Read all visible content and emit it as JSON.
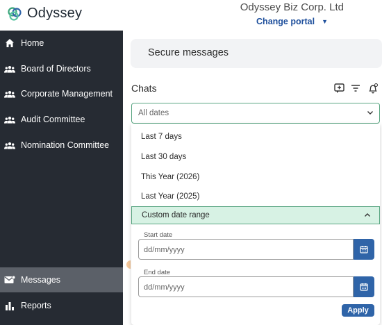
{
  "header": {
    "app_name": "Odyssey",
    "company": "Odyssey Biz Corp. Ltd",
    "change_portal": "Change portal"
  },
  "sidebar": {
    "items": [
      {
        "label": "Home",
        "icon": "home-icon"
      },
      {
        "label": "Board of Directors",
        "icon": "people-icon"
      },
      {
        "label": "Corporate Management",
        "icon": "people-icon"
      },
      {
        "label": "Audit Committee",
        "icon": "people-icon"
      },
      {
        "label": "Nomination Committee",
        "icon": "people-icon"
      },
      {
        "label": "Messages",
        "icon": "mail-icon",
        "active": true
      },
      {
        "label": "Reports",
        "icon": "bar-chart-icon"
      }
    ]
  },
  "main": {
    "title": "Secure messages",
    "chats_label": "Chats",
    "date_filter": {
      "selected": "All dates",
      "options": [
        "Last 7 days",
        "Last 30 days",
        "This Year (2026)",
        "Last Year (2025)"
      ],
      "custom_label": "Custom date range",
      "start_label": "Start date",
      "start_placeholder": "dd/mm/yyyy",
      "end_label": "End date",
      "end_placeholder": "dd/mm/yyyy",
      "apply_label": "Apply"
    }
  },
  "colors": {
    "sidebar_bg": "#262b33",
    "active_item": "#5b6068",
    "accent_green": "#5aa682",
    "primary_blue": "#2f64a8",
    "link_blue": "#1e4f9c"
  }
}
